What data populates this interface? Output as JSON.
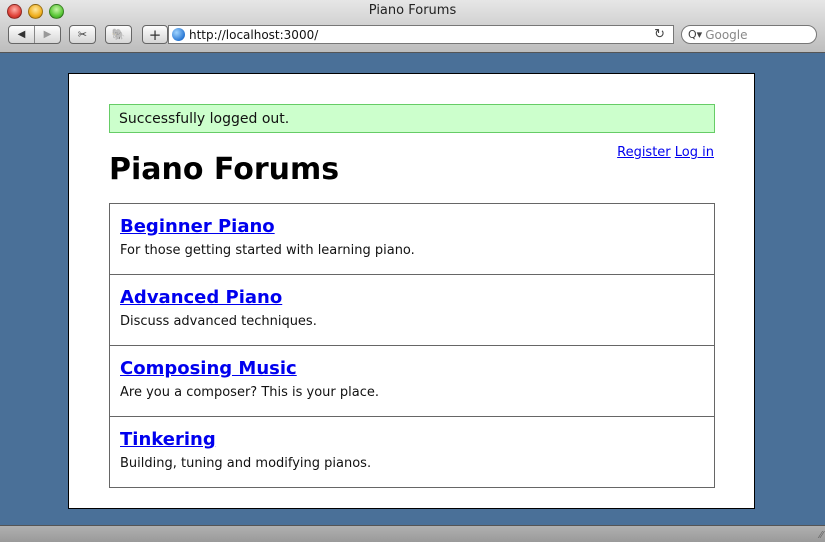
{
  "window": {
    "title": "Piano Forums",
    "url": "http://localhost:3000/",
    "search_placeholder": "Google",
    "icons": {
      "back": "◀",
      "forward": "▶",
      "clip": "✂",
      "evernote": "🐘",
      "add": "+",
      "reload": "↻",
      "search": "Q▾",
      "resize": "⁄⁄"
    }
  },
  "flash": {
    "message": "Successfully logged out."
  },
  "user_nav": {
    "register": "Register",
    "login": "Log in"
  },
  "page_title": "Piano Forums",
  "forums": [
    {
      "name": "Beginner Piano",
      "description": "For those getting started with learning piano."
    },
    {
      "name": "Advanced Piano",
      "description": "Discuss advanced techniques."
    },
    {
      "name": "Composing Music",
      "description": "Are you a composer? This is your place."
    },
    {
      "name": "Tinkering",
      "description": "Building, tuning and modifying pianos."
    }
  ]
}
